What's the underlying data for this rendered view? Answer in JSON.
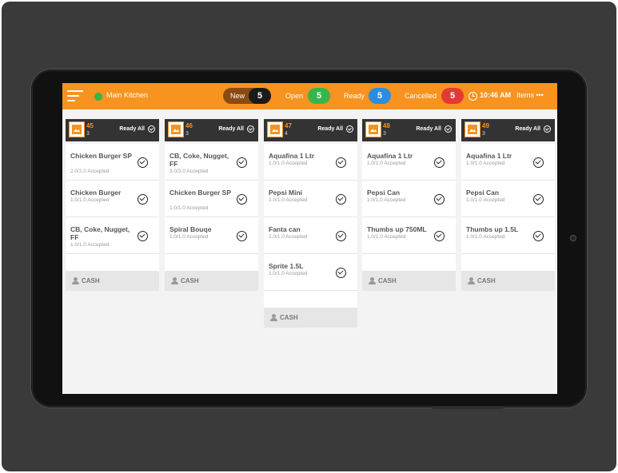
{
  "header": {
    "kitchen_label": "Main Kitchen",
    "filters": [
      {
        "label": "New",
        "count": "5",
        "color": "#1a1a1a"
      },
      {
        "label": "Open",
        "count": "5",
        "color": "#36b54a"
      },
      {
        "label": "Ready",
        "count": "5",
        "color": "#2b8de0"
      },
      {
        "label": "Cancelled",
        "count": "5",
        "color": "#e53935"
      }
    ],
    "time": "10:46 AM",
    "items_label": "Items •••"
  },
  "colors": {
    "accent": "#f7931e",
    "dark_header": "#333333"
  },
  "orders": [
    {
      "number": "45",
      "item_count": "3",
      "ready_all": "Ready All",
      "items": [
        {
          "name": "Chicken Burger SP",
          "status": "2.0/2.0 Accepted"
        },
        {
          "name": "Chicken Burger",
          "status": "1.0/1.0 Accepted"
        },
        {
          "name": "CB, Coke, Nugget, FF",
          "status": "1.0/1.0 Accepted"
        }
      ],
      "payment": "CASH"
    },
    {
      "number": "46",
      "item_count": "3",
      "ready_all": "Ready All",
      "items": [
        {
          "name": "CB, Coke, Nugget, FF",
          "status": "3.0/3.0 Accepted"
        },
        {
          "name": "Chicken Burger SP",
          "status": "1.0/1.0 Accepted"
        },
        {
          "name": "Spiral Bouqe",
          "status": "1.0/1.0 Accepted"
        }
      ],
      "payment": "CASH"
    },
    {
      "number": "47",
      "item_count": "4",
      "ready_all": "Ready All",
      "items": [
        {
          "name": "Aquafina 1 Ltr",
          "status": "1.0/1.0 Accepted"
        },
        {
          "name": "Pepsi Mini",
          "status": "1.0/1.0 Accepted"
        },
        {
          "name": "Fanta can",
          "status": "1.0/1.0 Accepted"
        },
        {
          "name": "Sprite 1.5L",
          "status": "1.0/1.0 Accepted"
        }
      ],
      "payment": "CASH"
    },
    {
      "number": "48",
      "item_count": "3",
      "ready_all": "Ready All",
      "items": [
        {
          "name": "Aquafina 1 Ltr",
          "status": "1.0/1.0 Accepted"
        },
        {
          "name": "Pepsi Can",
          "status": "1.0/1.0 Accepted"
        },
        {
          "name": "Thumbs up 750ML",
          "status": "1.0/1.0 Accepted"
        }
      ],
      "payment": "CASH"
    },
    {
      "number": "49",
      "item_count": "3",
      "ready_all": "Ready All",
      "items": [
        {
          "name": "Aquafina 1 Ltr",
          "status": "1.0/1.0 Accepted"
        },
        {
          "name": "Pepsi Can",
          "status": "1.0/1.0 Accepted"
        },
        {
          "name": "Thumbs up 1.5L",
          "status": "1.0/1.0 Accepted"
        }
      ],
      "payment": "CASH"
    }
  ]
}
